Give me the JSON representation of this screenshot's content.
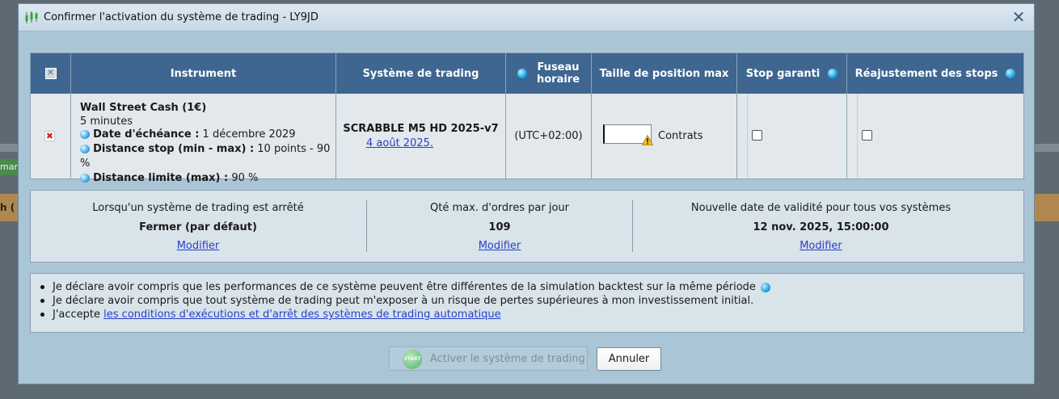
{
  "background": {
    "left_green_fragment": "marc",
    "left_orange_fragment": "h ("
  },
  "dialog": {
    "title": "Confirmer l'activation du système de trading  - LY9JD",
    "close_label": "✕"
  },
  "table": {
    "headers": {
      "instrument": "Instrument",
      "system": "Système de trading",
      "timezone": "Fuseau horaire",
      "position_size": "Taille de position max",
      "stop_guaranteed": "Stop garanti",
      "stop_adjust": "Réajustement des stops"
    },
    "row": {
      "instrument_name": "Wall Street Cash (1€)",
      "timeframe": "5 minutes",
      "expiry_label": "Date d'échéance :",
      "expiry_value": " 1 décembre 2029",
      "distance_stop_label": "Distance stop (min - max) :",
      "distance_stop_value": " 10 points - 90 %",
      "distance_limit_label": "Distance limite (max) :",
      "distance_limit_value": " 90 %",
      "system_name": "SCRABBLE M5 HD 2025-v7",
      "system_date": "4 août 2025.",
      "timezone": "(UTC+02:00)",
      "position_value": "",
      "position_unit": "Contrats",
      "stop_guaranteed_checked": false,
      "stop_adjust_checked": false
    }
  },
  "settings": {
    "col1": {
      "label": "Lorsqu'un système de trading est arrêté",
      "value": "Fermer (par défaut)",
      "modify": "Modifier"
    },
    "col2": {
      "label": "Qté max. d'ordres par jour",
      "value": "109",
      "modify": "Modifier"
    },
    "col3": {
      "label": "Nouvelle date de validité pour tous vos systèmes",
      "value": "12 nov. 2025, 15:00:00",
      "modify": "Modifier"
    }
  },
  "declarations": {
    "line1": "Je déclare avoir compris que les performances de ce système peuvent être différentes de la simulation backtest sur la même période",
    "line2": "Je déclare avoir compris que tout système de trading peut m'exposer à un risque de pertes supérieures à mon investissement initial.",
    "line3_prefix": "J'accepte ",
    "line3_link": "les conditions d'exécutions et d'arrêt des systèmes de trading automatique"
  },
  "buttons": {
    "activate_icon_text": "START",
    "activate": "Activer le système de trading",
    "cancel": "Annuler"
  },
  "colors": {
    "header_bg": "#3e6690",
    "dialog_bg": "#a9c5d6",
    "link": "#2a3fc9"
  }
}
